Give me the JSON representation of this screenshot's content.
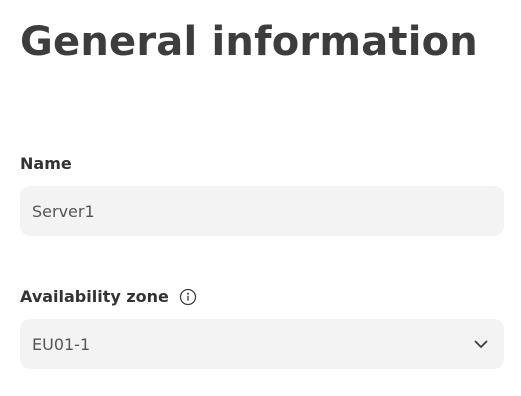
{
  "page": {
    "title": "General information"
  },
  "fields": {
    "name": {
      "label": "Name",
      "value": "Server1"
    },
    "availability_zone": {
      "label": "Availability zone",
      "value": "EU01-1",
      "info_icon": "info-icon",
      "dropdown_icon": "chevron-down-icon"
    }
  },
  "colors": {
    "field_background": "#f3f3f3",
    "text": "#3d3d3d"
  }
}
